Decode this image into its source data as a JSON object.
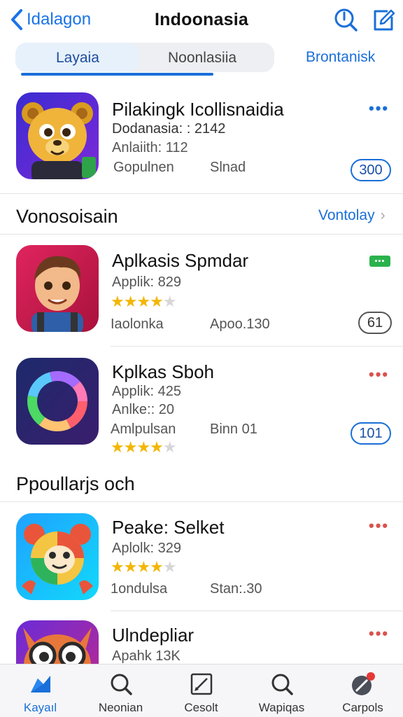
{
  "nav": {
    "back_label": "Idalagon",
    "title": "Indoonasia"
  },
  "tabs_top": {
    "active": "Layaia",
    "inactive": "Noonlasiia",
    "extra": "Brontanisk"
  },
  "featured": {
    "name": "Pilakingk Icollisnaidia",
    "line1": "Dodanasia: : 2142",
    "line2": "Anlaiith: 112",
    "meta_left": "Gopulnen",
    "meta_right": "Slnad",
    "action": "300",
    "more": "•••"
  },
  "section1": {
    "title": "Vonosoisain",
    "link": "Vontolay",
    "link_arrow": "›"
  },
  "apps": [
    {
      "name": "Aplkasis Spmdar",
      "line1": "Applik: 829",
      "rating": 4,
      "meta_left": "Iaolonka",
      "meta_right": "Apoo.130",
      "action": "61",
      "badge": "▪▪▪"
    },
    {
      "name": "Kplkas Sboh",
      "line1": "Applik: 425",
      "line2": "Anlke:: 20",
      "rating": 4,
      "meta_left": "Amlpulsan",
      "meta_right": "Binn 01",
      "action": "101",
      "more": "•••"
    }
  ],
  "section2": {
    "title": "Ppoullarjs och"
  },
  "popular": [
    {
      "name": "Peake: Selket",
      "line1": "Aplolk: 329",
      "rating": 4,
      "meta_left": "1ondulsa",
      "meta_right": "Stan:.30",
      "more": "•••"
    },
    {
      "name": "Ulndepliar",
      "line1": "Apahk 13K",
      "more": "•••"
    }
  ],
  "tabbar": {
    "items": [
      {
        "label": "Kayaıl",
        "icon": "apps-icon"
      },
      {
        "label": "Neonian",
        "icon": "search-icon"
      },
      {
        "label": "Cesolt",
        "icon": "edit-icon"
      },
      {
        "label": "Wapiqas",
        "icon": "search-icon"
      },
      {
        "label": "Carpols",
        "icon": "profile-icon"
      }
    ]
  },
  "colors": {
    "accent": "#1a6fd8",
    "star": "#f2b705",
    "more_red": "#d9534f",
    "badge_green": "#2bb24c"
  }
}
